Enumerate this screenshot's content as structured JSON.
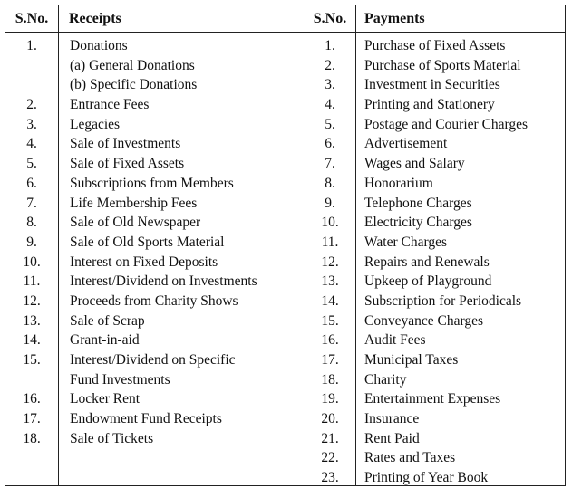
{
  "headers": {
    "receipts_sno": "S.No.",
    "receipts": "Receipts",
    "payments_sno": "S.No.",
    "payments": "Payments"
  },
  "receipts": [
    {
      "sno": "1.",
      "text": "Donations"
    },
    {
      "sno": "",
      "text": "(a) General Donations"
    },
    {
      "sno": "",
      "text": "(b) Specific Donations"
    },
    {
      "sno": "2.",
      "text": "Entrance Fees"
    },
    {
      "sno": "3.",
      "text": "Legacies"
    },
    {
      "sno": "4.",
      "text": "Sale of Investments"
    },
    {
      "sno": "5.",
      "text": "Sale of Fixed Assets"
    },
    {
      "sno": "6.",
      "text": "Subscriptions from Members"
    },
    {
      "sno": "7.",
      "text": "Life Membership Fees"
    },
    {
      "sno": "8.",
      "text": "Sale of Old Newspaper"
    },
    {
      "sno": "9.",
      "text": "Sale of Old Sports Material"
    },
    {
      "sno": "10.",
      "text": "Interest on Fixed Deposits"
    },
    {
      "sno": "11.",
      "text": "Interest/Dividend on Investments"
    },
    {
      "sno": "12.",
      "text": "Proceeds from Charity Shows"
    },
    {
      "sno": "13.",
      "text": "Sale of Scrap"
    },
    {
      "sno": "14.",
      "text": "Grant-in-aid"
    },
    {
      "sno": "15.",
      "text": "Interest/Dividend on Specific"
    },
    {
      "sno": "",
      "text": "Fund Investments"
    },
    {
      "sno": "16.",
      "text": "Locker Rent"
    },
    {
      "sno": "17.",
      "text": "Endowment Fund Receipts"
    },
    {
      "sno": "18.",
      "text": "Sale of Tickets"
    }
  ],
  "payments": [
    {
      "sno": "1.",
      "text": "Purchase of Fixed Assets"
    },
    {
      "sno": "2.",
      "text": "Purchase of Sports Material"
    },
    {
      "sno": "3.",
      "text": "Investment in Securities"
    },
    {
      "sno": "4.",
      "text": "Printing and Stationery"
    },
    {
      "sno": "5.",
      "text": "Postage and Courier Charges"
    },
    {
      "sno": "6.",
      "text": "Advertisement"
    },
    {
      "sno": "7.",
      "text": "Wages and Salary"
    },
    {
      "sno": "8.",
      "text": "Honorarium"
    },
    {
      "sno": "9.",
      "text": "Telephone Charges"
    },
    {
      "sno": "10.",
      "text": "Electricity Charges"
    },
    {
      "sno": "11.",
      "text": "Water Charges"
    },
    {
      "sno": "12.",
      "text": "Repairs and Renewals"
    },
    {
      "sno": "13.",
      "text": "Upkeep of Playground"
    },
    {
      "sno": "14.",
      "text": "Subscription for Periodicals"
    },
    {
      "sno": "15.",
      "text": "Conveyance Charges"
    },
    {
      "sno": "16.",
      "text": "Audit Fees"
    },
    {
      "sno": "17.",
      "text": "Municipal Taxes"
    },
    {
      "sno": "18.",
      "text": "Charity"
    },
    {
      "sno": "19.",
      "text": "Entertainment Expenses"
    },
    {
      "sno": "20.",
      "text": "Insurance"
    },
    {
      "sno": "21.",
      "text": "Rent Paid"
    },
    {
      "sno": "22.",
      "text": "Rates and Taxes"
    },
    {
      "sno": "23.",
      "text": "Printing of Year Book"
    }
  ]
}
